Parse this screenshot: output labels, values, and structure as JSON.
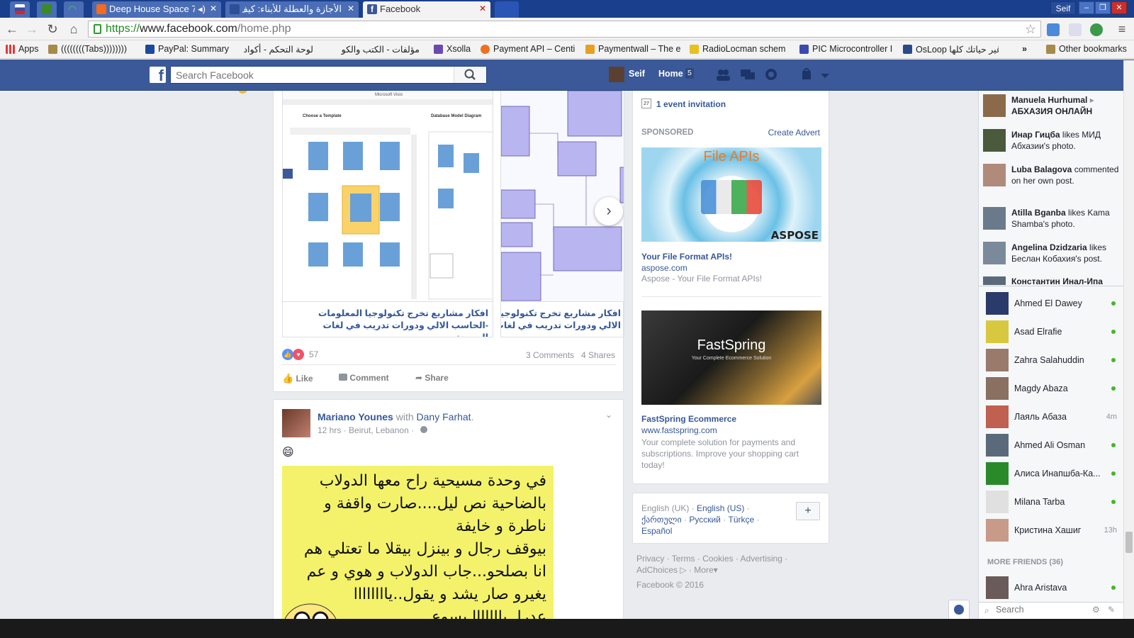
{
  "browser": {
    "tabs": [
      {
        "title": "Deep House Space 78",
        "has_audio": true
      },
      {
        "title": "الأجازة والعطلة للأبناء: كيف"
      },
      {
        "title": "Facebook"
      }
    ],
    "profile": "Seif",
    "url_scheme": "https://",
    "url_host": "www.facebook.com",
    "url_path": "/home.php",
    "window_buttons": [
      "–",
      "❐",
      "✕"
    ]
  },
  "bookmarks": [
    {
      "label": "Apps"
    },
    {
      "label": "((((((((Tabs))))))))"
    },
    {
      "label": "PayPal: Summary"
    },
    {
      "label": "لوحة التحكم - أكواد"
    },
    {
      "label": "مؤلفات - الكتب والكو"
    },
    {
      "label": "Xsolla"
    },
    {
      "label": "Payment API – Centi"
    },
    {
      "label": "Paymentwall – The e"
    },
    {
      "label": "RadioLocman schem"
    },
    {
      "label": "PIC Microcontroller I"
    },
    {
      "label": "OsLoop غير حياتك كلها"
    },
    {
      "label": "»"
    },
    {
      "label": "Other bookmarks"
    }
  ],
  "fb_header": {
    "search_placeholder": "Search Facebook",
    "user_name": "Seif",
    "home_label": "Home",
    "home_count": "5"
  },
  "post1": {
    "carousel": [
      {
        "caption": "افكار مشاريع تخرج تكنولوجيا المعلومات -الحاسب الالي ودورات تدريب في لغات البرمجة"
      },
      {
        "caption": "افكار مشاريع تخرج تكنولوجيا المعلومات -الحاسب الالي ودورات تدريب في لغات البرمجة"
      }
    ],
    "visio_window_title": "Microsoft Visio",
    "visio_heading": "Choose a Template",
    "visio_preview": "Database Model Diagram",
    "reactions_count": "57",
    "comments": "3 Comments",
    "shares": "4 Shares",
    "actions": [
      "Like",
      "Comment",
      "Share"
    ]
  },
  "post2": {
    "author": "Mariano Younes",
    "with_word": "with",
    "tagged": "Dany Farhat",
    "meta": "12 hrs · Beirut, Lebanon ·",
    "emoji": "😄",
    "image_text": [
      "في وحدة مسيحية راح معها الدولاب",
      "بالضاحية نص ليل....صارت واقفة و",
      "ناطرة و خايفة",
      "بيوقف رجال و بينزل بيقلا ما تعتلي هم",
      "انا بصلحو...جاب الدولاب و هوي و عم",
      "يغيرو صار يشد و يقول..ياااااااا",
      "عدرا..يااااااا يسوع"
    ]
  },
  "right_col": {
    "event_icon_day": "27",
    "event_text": "1 event invitation",
    "sponsored_label": "SPONSORED",
    "create_advert": "Create Advert",
    "ads": [
      {
        "image_text": "File APIs",
        "brand": "ASPOSE",
        "title": "Your File Format APIs!",
        "site": "aspose.com",
        "desc": "Aspose - Your File Format APIs!"
      },
      {
        "image_text": "FastSpring",
        "image_sub": "Your Complete Ecommerce Solution",
        "title": "FastSpring Ecommerce",
        "site": "www.fastspring.com",
        "desc": "Your complete solution for payments and subscriptions. Improve your shopping cart today!"
      }
    ],
    "languages": {
      "current": "English (UK)",
      "others": [
        "English (US)",
        "ქართული",
        "Русский",
        "Türkçe",
        "Español"
      ]
    },
    "footer_links": [
      "Privacy",
      "Terms",
      "Cookies",
      "Advertising",
      "AdChoices",
      "More"
    ],
    "copyright": "Facebook © 2016"
  },
  "ticker": [
    {
      "name": "Manuela Hurhumal",
      "rest": "АБХАЗИЯ ОНЛАЙН",
      "color": "#8a6a4a"
    },
    {
      "name": "Инар Гицба",
      "rest": " likes МИД Абхазии's photo.",
      "color": "#4a5a3a"
    },
    {
      "name": "Luba Balagova",
      "rest": " commented on her own post.",
      "color": "#b08a7a"
    },
    {
      "name": "Atilla Bganba",
      "rest": " likes Kama Shamba's photo.",
      "color": "#6a7a8a"
    },
    {
      "name": "Angelina Dzidzaria",
      "rest": " likes Беслан Кобахия's post.",
      "color": "#7a8a9a"
    },
    {
      "name": "Константин Инал-Ипа",
      "rest": "",
      "color": "#5a6a7a"
    }
  ],
  "chat": {
    "friends": [
      {
        "name": "Ahmed El Dawey",
        "status": "online",
        "color": "#2a3a6a"
      },
      {
        "name": "Asad Elrafie",
        "status": "online",
        "color": "#d8c840"
      },
      {
        "name": "Zahra Salahuddin",
        "status": "online",
        "color": "#9a7a6a"
      },
      {
        "name": "Magdy Abaza",
        "status": "online",
        "color": "#8a7060"
      },
      {
        "name": "Лаяль Абаза",
        "status": "4m",
        "color": "#c06050"
      },
      {
        "name": "Ahmed Ali Osman",
        "status": "online",
        "color": "#5a6a7a"
      },
      {
        "name": "Алиса Инапшба-Ка...",
        "status": "online",
        "color": "#2a8a2a"
      },
      {
        "name": "Milana Tarba",
        "status": "online",
        "color": "#e0e0e0"
      },
      {
        "name": "Кристина Хашиг",
        "status": "13h",
        "color": "#c89a8a"
      }
    ],
    "more_friends_label": "MORE FRIENDS (36)",
    "more": [
      {
        "name": "Ahra Aristava",
        "status": "online",
        "color": "#6a5a5a"
      }
    ],
    "search_placeholder": "Search"
  }
}
